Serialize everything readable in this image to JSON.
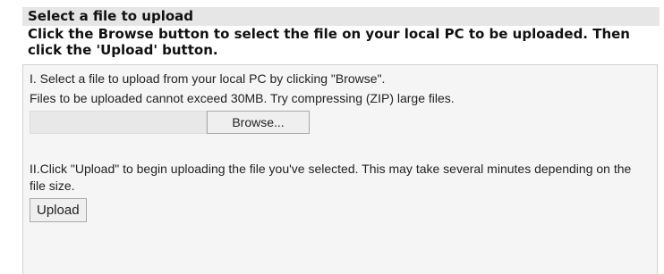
{
  "panel": {
    "title": "Select a file to upload",
    "instructions": "Click the Browse button to select the file on your local PC to be uploaded. Then click the 'Upload' button."
  },
  "steps": {
    "step1_line1": "I. Select a file to upload from your local PC by clicking \"Browse\".",
    "step1_line2": "Files to be uploaded cannot exceed 30MB. Try compressing (ZIP) large files.",
    "file_path_value": "",
    "browse_label": "Browse...",
    "step2_text": "II.Click \"Upload\" to begin uploading the file you've selected. This may take several minutes depending on the file size.",
    "upload_label": "Upload"
  },
  "colors": {
    "title_bar_bg": "#e6e6e6",
    "content_bg": "#f5f5f5",
    "border": "#d2d2d2",
    "button_bg": "#efefef"
  }
}
